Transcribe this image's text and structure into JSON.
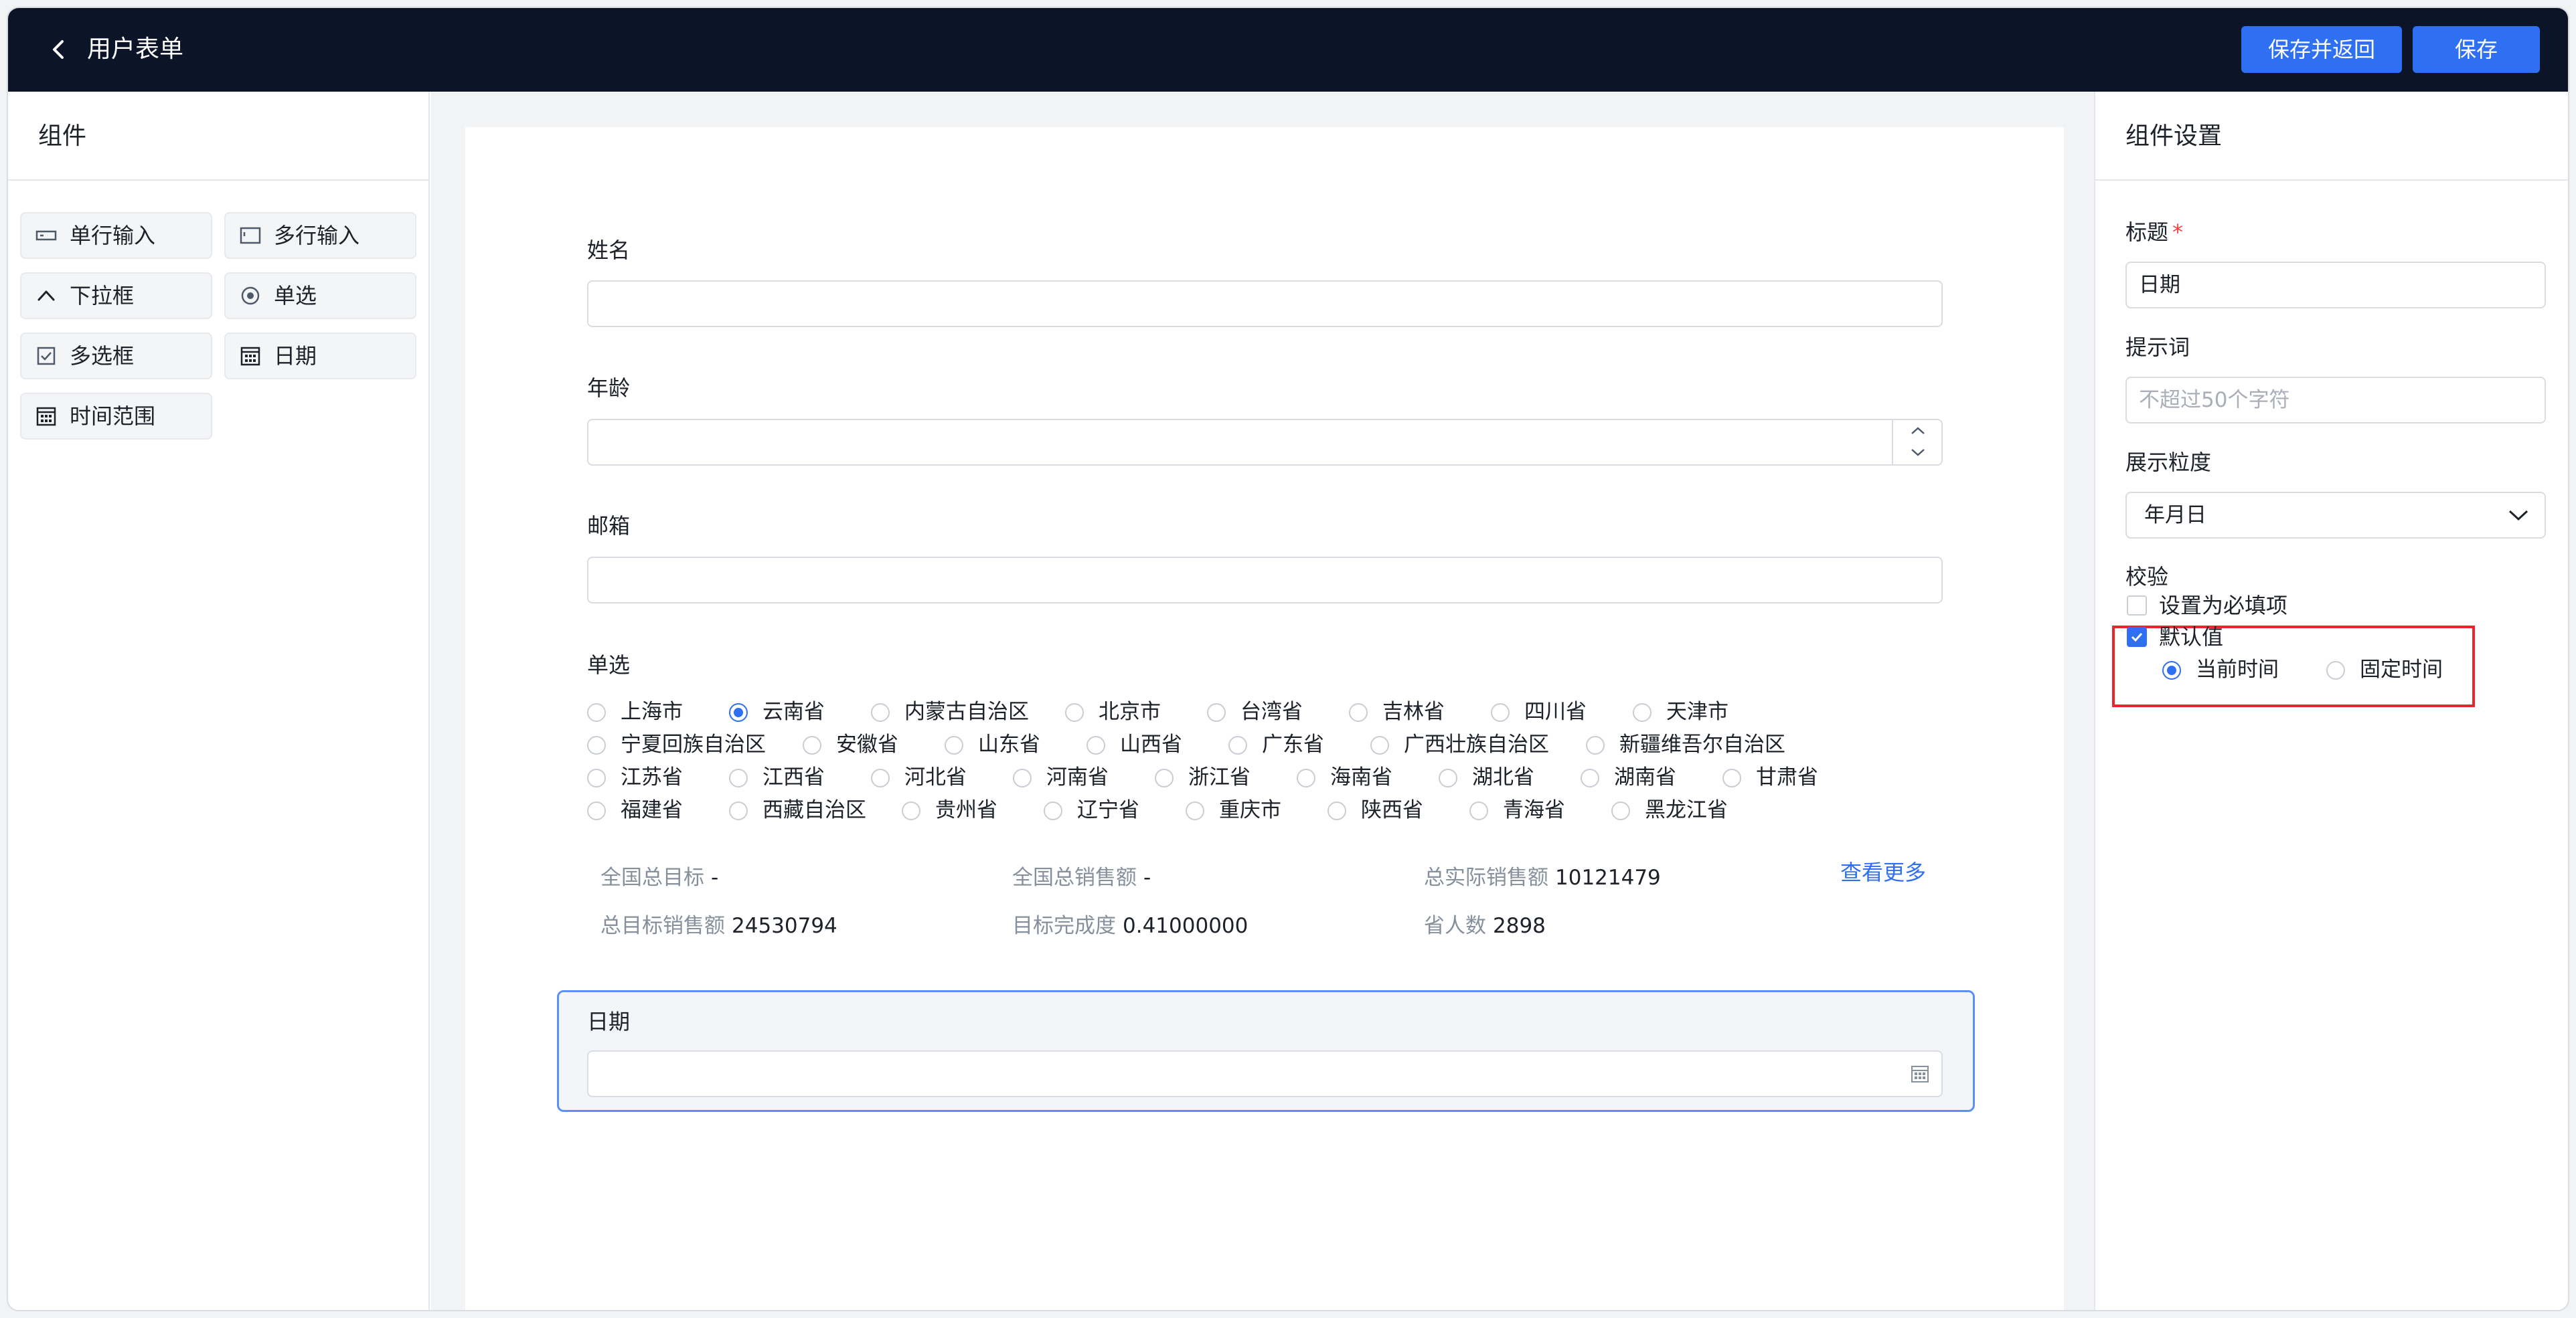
{
  "header": {
    "title": "用户表单",
    "save_return_label": "保存并返回",
    "save_label": "保存"
  },
  "components_panel": {
    "title": "组件",
    "items": [
      {
        "label": "单行输入",
        "icon": "single-line-input-icon"
      },
      {
        "label": "多行输入",
        "icon": "multi-line-input-icon"
      },
      {
        "label": "下拉框",
        "icon": "chevron-up-icon"
      },
      {
        "label": "单选",
        "icon": "radio-icon"
      },
      {
        "label": "多选框",
        "icon": "checkbox-icon"
      },
      {
        "label": "日期",
        "icon": "calendar-icon"
      },
      {
        "label": "时间范围",
        "icon": "calendar-icon"
      }
    ]
  },
  "form": {
    "name_label": "姓名",
    "age_label": "年龄",
    "email_label": "邮箱",
    "radio_label": "单选",
    "radio_selected": "云南省",
    "radio_options": [
      [
        "上海市",
        "云南省",
        "内蒙古自治区",
        "北京市",
        "台湾省",
        "吉林省",
        "四川省",
        "天津市"
      ],
      [
        "宁夏回族自治区",
        "安徽省",
        "山东省",
        "山西省",
        "广东省",
        "广西壮族自治区",
        "新疆维吾尔自治区"
      ],
      [
        "江苏省",
        "江西省",
        "河北省",
        "河南省",
        "浙江省",
        "海南省",
        "湖北省",
        "湖南省",
        "甘肃省"
      ],
      [
        "福建省",
        "西藏自治区",
        "贵州省",
        "辽宁省",
        "重庆市",
        "陕西省",
        "青海省",
        "黑龙江省"
      ]
    ],
    "stats": {
      "national_target_label": "全国总目标",
      "national_target_value": "-",
      "national_sales_label": "全国总销售额",
      "national_sales_value": "-",
      "actual_sales_label": "总实际销售额",
      "actual_sales_value": "10121479",
      "target_sales_label": "总目标销售额",
      "target_sales_value": "24530794",
      "completion_label": "目标完成度",
      "completion_value": "0.41000000",
      "province_count_label": "省人数",
      "province_count_value": "2898",
      "more_link": "查看更多"
    },
    "date_label": "日期"
  },
  "settings_panel": {
    "title": "组件设置",
    "title_field_label": "标题",
    "required_mark": "*",
    "title_field_value": "日期",
    "hint_label": "提示词",
    "hint_placeholder": "不超过50个字符",
    "granularity_label": "展示粒度",
    "granularity_value": "年月日",
    "validation_label": "校验",
    "required_checkbox_label": "设置为必填项",
    "required_checked": false,
    "default_value_label": "默认值",
    "default_value_checked": true,
    "default_options": [
      "当前时间",
      "固定时间"
    ],
    "default_selected": "当前时间"
  },
  "colors": {
    "topbar": "#0c1428",
    "primary": "#2f6ff2",
    "highlight_box": "#e8262b"
  }
}
